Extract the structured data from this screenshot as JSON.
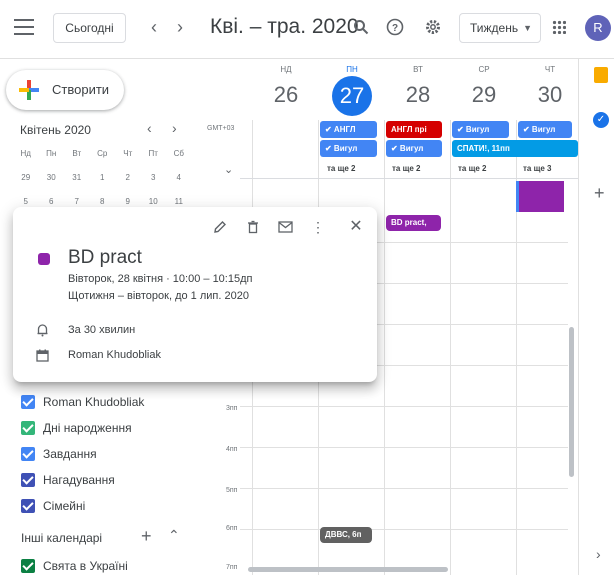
{
  "header": {
    "today_label": "Сьогодні",
    "prev_icon": "chevron-left-icon",
    "next_icon": "chevron-right-icon",
    "date_range": "Кві. – тра. 2020",
    "view_label": "Тиждень",
    "avatar_letter": "R"
  },
  "create": {
    "label": "Створити"
  },
  "mini_calendar": {
    "title": "Квітень 2020",
    "weekdays": [
      "Нд",
      "Пн",
      "Вт",
      "Ср",
      "Чт",
      "Пт",
      "Сб"
    ],
    "weeks": [
      [
        "29",
        "30",
        "31",
        "1",
        "2",
        "3",
        "4"
      ],
      [
        "5",
        "6",
        "7",
        "8",
        "9",
        "10",
        "11"
      ]
    ]
  },
  "timezone": "GMT+03",
  "days": [
    {
      "name": "НД",
      "date": "26"
    },
    {
      "name": "ПН",
      "date": "27"
    },
    {
      "name": "ВТ",
      "date": "28"
    },
    {
      "name": "СР",
      "date": "29"
    },
    {
      "name": "ЧТ",
      "date": "30"
    }
  ],
  "allday": {
    "mon_1": "✔ АНГЛ",
    "mon_2": "✔ Вигул",
    "tue_1": "АНГЛ прі",
    "tue_2": "✔ Вигул",
    "wed_1": "✔ Вигул",
    "wed_2": "СПАТИ!, 11пп",
    "thu_1": "✔ Вигул",
    "more_mon": "та ще 2",
    "more_tue": "та ще 2",
    "more_wed": "та ще 2",
    "more_thu": "та ще 3"
  },
  "events": {
    "bd_pract": "BD pract,",
    "dvvs": "ДВВС, 6п"
  },
  "times": [
    "3пп",
    "4пп",
    "5пп",
    "6пп",
    "7пп"
  ],
  "popup": {
    "title": "BD pract",
    "datetime": "Вівторок, 28 квітня  ·  10:00 – 10:15дп",
    "recurrence": "Щотижня – вівторок, до 1 лип. 2020",
    "reminder": "За 30 хвилин",
    "owner": "Roman Khudobliak"
  },
  "my_calendars": [
    {
      "label": "Roman Khudobliak",
      "color": "#4285f4"
    },
    {
      "label": "Дні народження",
      "color": "#33b679"
    },
    {
      "label": "Завдання",
      "color": "#4285f4"
    },
    {
      "label": "Нагадування",
      "color": "#3f51b5"
    },
    {
      "label": "Сімейні",
      "color": "#3f51b5"
    }
  ],
  "other_calendars": {
    "title": "Інші календарі",
    "items": [
      {
        "label": "Свята в Україні",
        "color": "#0b8043"
      }
    ]
  },
  "colors": {
    "accent": "#1a73e8",
    "event_purple": "#8e24aa",
    "chip_blue": "#4285f4",
    "chip_red": "#d50000",
    "event_grey": "#616161"
  }
}
